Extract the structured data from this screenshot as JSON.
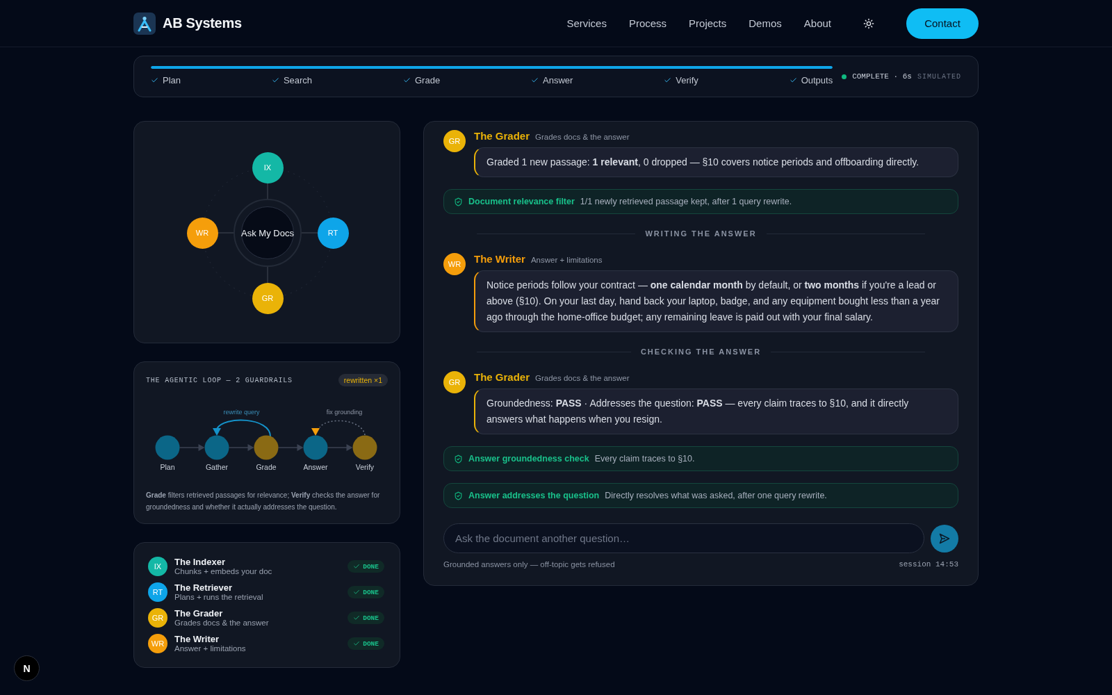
{
  "header": {
    "brand": "AB Systems",
    "nav": [
      "Services",
      "Process",
      "Projects",
      "Demos",
      "About"
    ],
    "contact_button": "Contact"
  },
  "progress": {
    "level": 1,
    "steps": [
      {
        "label": "Plan",
        "done": true
      },
      {
        "label": "Search",
        "done": true
      },
      {
        "label": "Grade",
        "done": true
      },
      {
        "label": "Answer",
        "done": true
      },
      {
        "label": "Verify",
        "done": true
      },
      {
        "label": "Outputs",
        "done": true
      }
    ],
    "status": {
      "complete": true,
      "label": "COMPLETE · 6s",
      "mode": "SIMULATED"
    }
  },
  "agent_graph": {
    "hub": "Ask My Docs",
    "nodes": [
      {
        "initials": "IX",
        "color": "#14b8a6"
      },
      {
        "initials": "RT",
        "color": "#0ea5e9"
      },
      {
        "initials": "GR",
        "color": "#eab308"
      },
      {
        "initials": "WR",
        "color": "#f59e0b"
      }
    ]
  },
  "loop": {
    "title": "THE AGENTIC LOOP — 2 GUARDRAILS",
    "badge": "rewritten ×1",
    "steps": [
      {
        "label": "Plan",
        "color": "#0b6687"
      },
      {
        "label": "Gather",
        "color": "#0b6687"
      },
      {
        "label": "Grade",
        "color": "#8a6a14"
      },
      {
        "label": "Answer",
        "color": "#0b6687"
      },
      {
        "label": "Verify",
        "color": "#8a6a14"
      }
    ],
    "edges": [
      {
        "kind": "rewrite",
        "label": "rewrite query"
      },
      {
        "kind": "fix",
        "label": "fix grounding"
      }
    ],
    "description": "**Grade** filters retrieved passages for relevance; **Verify** checks the answer for groundedness and whether it actually addresses the question."
  },
  "agents": [
    {
      "initials": "IX",
      "name": "The Indexer",
      "description": "Chunks + embeds your doc",
      "color": "#14b8a6",
      "status": "DONE",
      "done": true
    },
    {
      "initials": "RT",
      "name": "The Retriever",
      "description": "Plans + runs the retrieval",
      "color": "#0ea5e9",
      "status": "DONE",
      "done": true
    },
    {
      "initials": "GR",
      "name": "The Grader",
      "description": "Grades docs & the answer",
      "color": "#eab308",
      "status": "DONE",
      "done": true
    },
    {
      "initials": "WR",
      "name": "The Writer",
      "description": "Answer + limitations",
      "color": "#f59e0b",
      "status": "DONE",
      "done": true
    }
  ],
  "chat": {
    "items": [
      {
        "kind": "message",
        "initials": "GR",
        "name": "The Grader",
        "role": "Grades docs & the answer",
        "color": "#eab308",
        "text": "Graded 1 new passage: **1 relevant**, 0 dropped — §10 covers notice periods and offboarding directly."
      },
      {
        "kind": "guardrail",
        "passed": true,
        "title": "Document relevance filter",
        "text": "1/1 newly retrieved passage kept, after 1 query rewrite."
      },
      {
        "kind": "divider",
        "label": "WRITING THE ANSWER"
      },
      {
        "kind": "message",
        "initials": "WR",
        "name": "The Writer",
        "role": "Answer + limitations",
        "color": "#f59e0b",
        "text": "Notice periods follow your contract — **one calendar month** by default, or **two months** if you're a lead or above (§10). On your last day, hand back your laptop, badge, and any equipment bought less than a year ago through the home-office budget; any remaining leave is paid out with your final salary."
      },
      {
        "kind": "divider",
        "label": "CHECKING THE ANSWER"
      },
      {
        "kind": "message",
        "initials": "GR",
        "name": "The Grader",
        "role": "Grades docs & the answer",
        "color": "#eab308",
        "text": "Groundedness: **PASS** · Addresses the question: **PASS** — every claim traces to §10, and it directly answers what happens when you resign."
      },
      {
        "kind": "guardrail",
        "passed": true,
        "title": "Answer groundedness check",
        "text": "Every claim traces to §10."
      },
      {
        "kind": "guardrail",
        "passed": true,
        "title": "Answer addresses the question",
        "text": "Directly resolves what was asked, after one query rewrite."
      }
    ],
    "input": {
      "placeholder": "Ask the document another question…"
    },
    "hint": "Grounded answers only — off-topic gets refused",
    "session": "session 14:53"
  },
  "dev_indicator": "N"
}
